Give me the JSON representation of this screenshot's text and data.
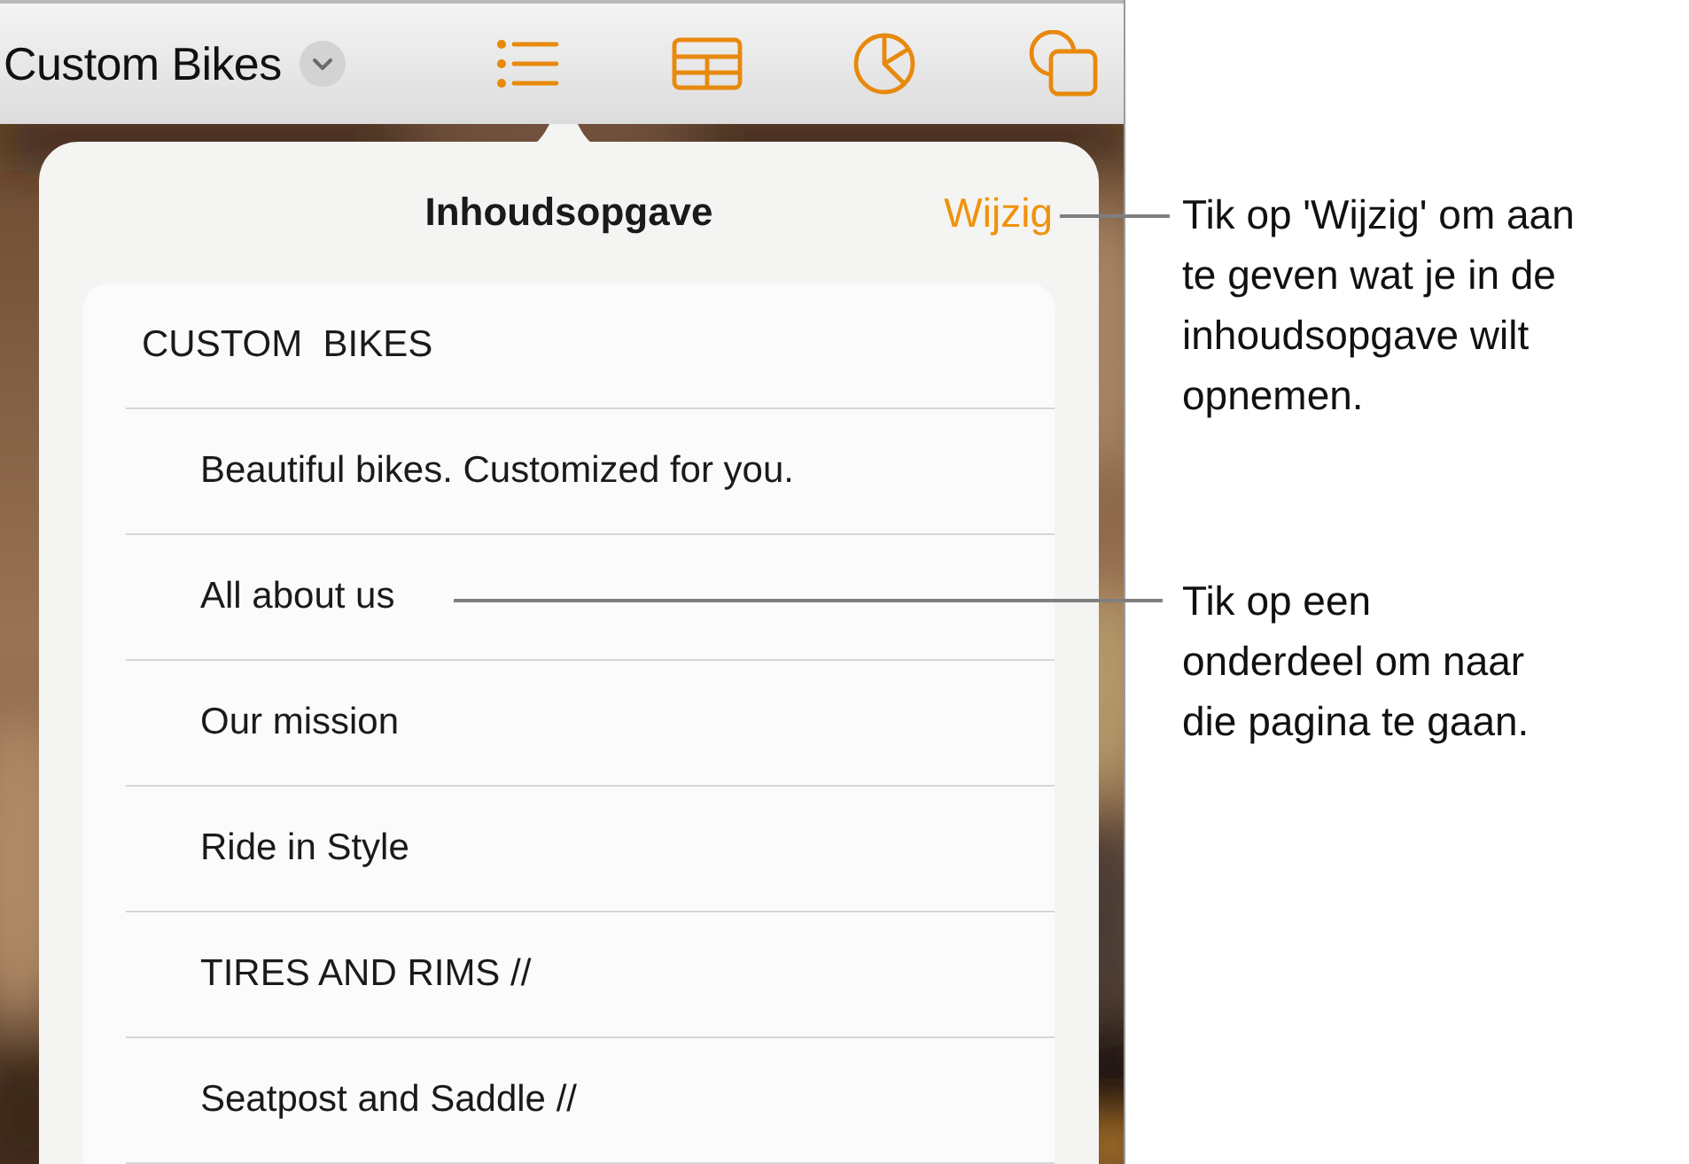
{
  "document": {
    "title": "Custom Bikes"
  },
  "popover": {
    "title": "Inhoudsopgave",
    "edit_button": "Wijzig",
    "toc": [
      {
        "label": "CUSTOM  BIKES",
        "children": [
          {
            "label": "Beautiful bikes. Customized for you."
          },
          {
            "label": "All about us"
          },
          {
            "label": "Our mission"
          },
          {
            "label": "Ride in Style"
          },
          {
            "label": "TIRES AND RIMS //"
          },
          {
            "label": "Seatpost and Saddle //"
          }
        ]
      }
    ]
  },
  "callouts": [
    {
      "text": "Tik op 'Wijzig' om aan te geven wat je in de inhoudsopgave wilt opnemen."
    },
    {
      "text": "Tik op een onderdeel om naar die pagina te gaan."
    }
  ]
}
